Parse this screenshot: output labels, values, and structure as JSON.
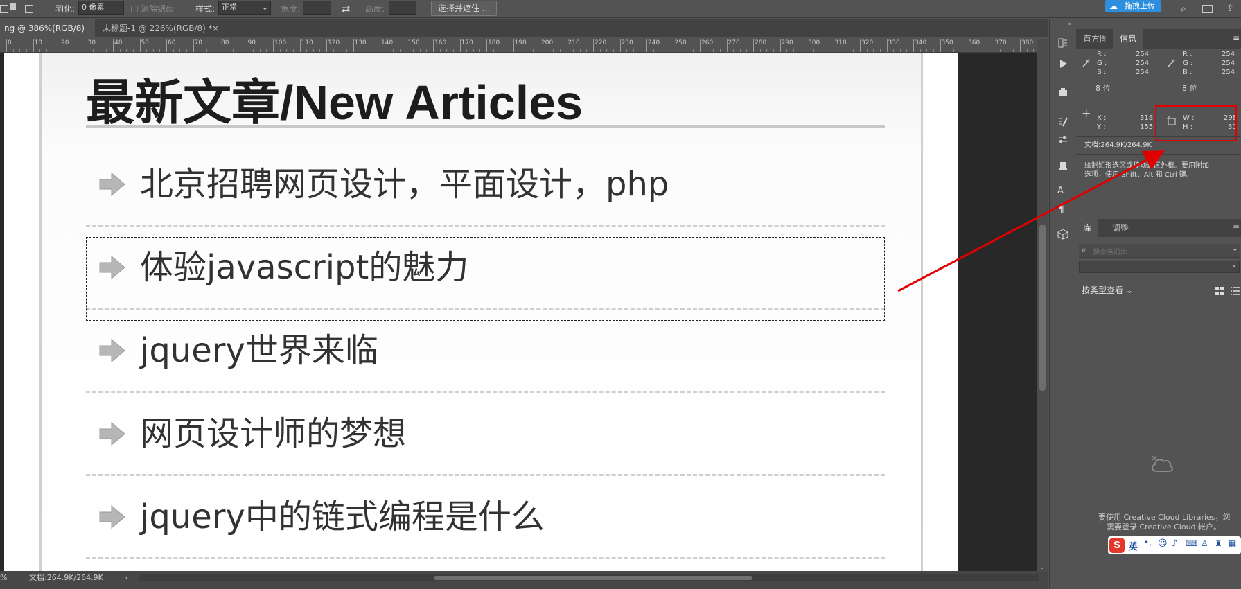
{
  "options_bar": {
    "feather_label": "羽化:",
    "feather_value": "0 像素",
    "antialias_label": "消除锯齿",
    "style_label": "样式:",
    "style_value": "正常",
    "width_label": "宽度:",
    "height_label": "高度:",
    "select_mask_label": "选择并遮住 ...",
    "upload_label": "拖拽上传"
  },
  "tabs": [
    {
      "label": "ng @ 386%(RGB/8) *",
      "close": "×"
    },
    {
      "label": "未标题-1 @ 226%(RGB/8) *",
      "close": "×"
    }
  ],
  "ruler_ticks": [
    "0",
    "10",
    "20",
    "30",
    "40",
    "50",
    "60",
    "70",
    "80",
    "90",
    "100",
    "110",
    "120",
    "130",
    "140",
    "150",
    "160",
    "170",
    "180",
    "190",
    "200",
    "210",
    "220",
    "230",
    "240",
    "250",
    "260",
    "270",
    "280",
    "290",
    "300",
    "310",
    "320",
    "330",
    "340",
    "350",
    "360",
    "370",
    "380"
  ],
  "document": {
    "heading": "最新文章/New Articles",
    "articles": [
      "北京招聘网页设计，平面设计，php",
      "体验javascript的魅力",
      "jquery世界来临",
      "网页设计师的梦想",
      "jquery中的链式编程是什么"
    ]
  },
  "status_bar": {
    "zoom": "%",
    "doc_info": "文档:264.9K/264.9K",
    "arrow": "›"
  },
  "panel": {
    "tabs": [
      "直方图",
      "信息"
    ],
    "info": {
      "r_label": "R :",
      "g_label": "G :",
      "b_label": "B :",
      "r1": "254",
      "g1": "254",
      "b1": "254",
      "r2": "254",
      "g2": "254",
      "b2": "254",
      "bit1": "8 位",
      "bit2": "8 位",
      "x_label": "X :",
      "y_label": "Y :",
      "x": "318",
      "y": "155",
      "w_label": "W :",
      "h_label": "H :",
      "w": "298",
      "h": "30",
      "doc": "文档:264.9K/264.9K",
      "hint_line1": "绘制矩形选区或移动选区外框。要用附加",
      "hint_line2": "选项，使用 Shift、Alt 和 Ctrl 键。"
    },
    "lib_tabs": [
      "库",
      "调整"
    ],
    "search_placeholder": "搜索当前库",
    "view_by_type": "按类型查看",
    "cc_line1": "要使用 Creative Cloud Libraries，您",
    "cc_line2": "需要登录 Creative Cloud 帐户。",
    "ime_label": "英"
  },
  "colors": {
    "accent_blue": "#2e8fde",
    "annotation_red": "#e00000",
    "ime_red": "#e5372b"
  },
  "icons": [
    "rect-selection-icon",
    "add-selection-icon",
    "intersect-selection-icon",
    "swap-icon",
    "play-icon",
    "brush-icon",
    "eyedropper-icon",
    "crosshair-icon",
    "paragraph-icon",
    "cube-icon",
    "search-icon",
    "creative-cloud-icon",
    "grid-view-icon",
    "list-view-icon",
    "arrow-bullet-icon"
  ]
}
